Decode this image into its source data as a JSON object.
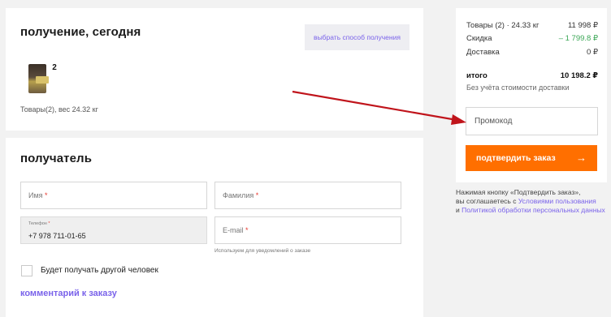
{
  "delivery": {
    "title": "получение, сегодня",
    "choose_method_button": "выбрать способ получения",
    "product_count_badge": "2",
    "items_weight": "Товары(2), вес 24.32 кг"
  },
  "recipient": {
    "title": "получатель",
    "name_label": "Имя",
    "surname_label": "Фамилия",
    "phone_label": "Телефон",
    "phone_value": "+7 978 711-01-65",
    "email_label": "E-mail",
    "required_mark": "*",
    "email_hint": "Используем для уведомлений о заказе",
    "other_person_label": "Будет получать другой человек",
    "comment_link": "комментарий к заказу"
  },
  "summary": {
    "goods_label": "Товары (2) · 24.33 кг",
    "goods_value": "11 998 ₽",
    "discount_label": "Скидка",
    "discount_value": "– 1 799.8 ₽",
    "delivery_label": "Доставка",
    "delivery_value": "0 ₽",
    "total_label": "итого",
    "total_value": "10 198.2 ₽",
    "total_note": "Без учёта стоимости доставки",
    "promo_placeholder": "Промокод",
    "confirm_button": "подтвердить заказ",
    "confirm_icon": "→"
  },
  "agreement": {
    "line1": "Нажимая кнопку «Подтвердить заказ»,",
    "line2_prefix": "вы соглашаетесь с ",
    "terms_link": "Условиями пользования",
    "line3_prefix": "и ",
    "privacy_link": "Политикой обработки персональных данных"
  },
  "colors": {
    "accent_purple": "#7a63ea",
    "confirm_orange": "#ff6f00",
    "discount_green": "#3aa655",
    "annotation_arrow": "#c0141b"
  }
}
